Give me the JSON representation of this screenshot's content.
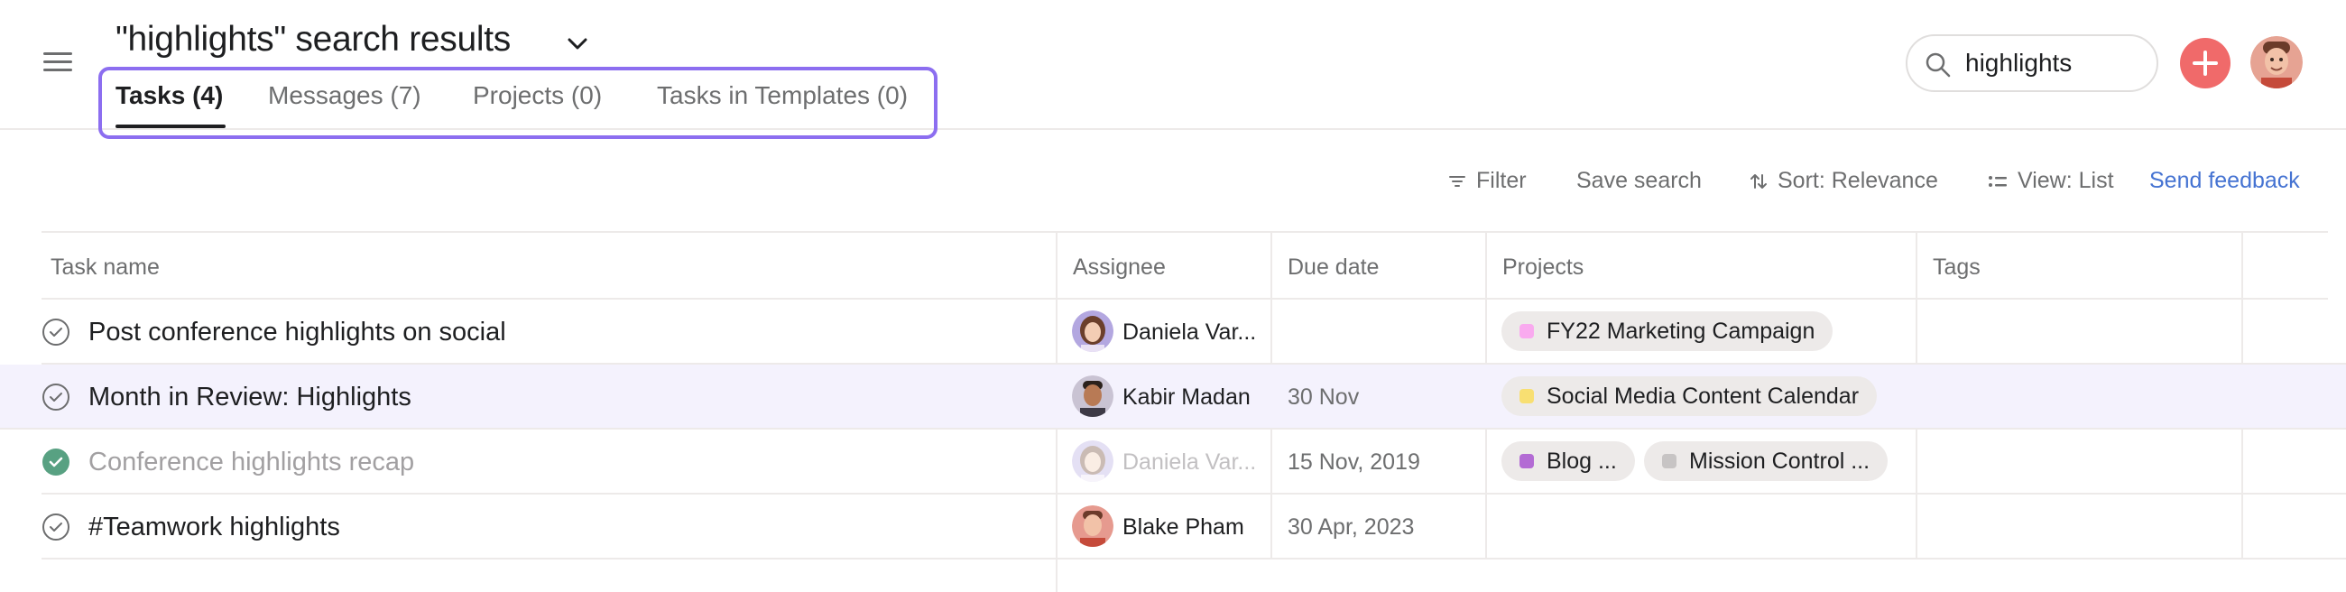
{
  "header": {
    "title": "\"highlights\" search results",
    "tabs": [
      {
        "label": "Tasks (4)"
      },
      {
        "label": "Messages (7)"
      },
      {
        "label": "Projects (0)"
      },
      {
        "label": "Tasks in Templates (0)"
      }
    ],
    "active_tab": "Tasks (4)",
    "search_value": "highlights",
    "icons": [
      "hamburger-menu-icon",
      "chevron-down-icon",
      "search-icon",
      "plus-icon",
      "user-avatar"
    ]
  },
  "toolbar": {
    "filter": "Filter",
    "save_search": "Save search",
    "sort": "Sort: Relevance",
    "view": "View: List",
    "feedback": "Send feedback"
  },
  "table": {
    "columns": [
      "Task name",
      "Assignee",
      "Due date",
      "Projects",
      "Tags"
    ],
    "rows": [
      {
        "name": "Post conference highlights on social",
        "completed": false,
        "assignee": "Daniela Var...",
        "due": "",
        "projects": [
          {
            "label": "FY22 Marketing Campaign",
            "color": "#f9aaef"
          }
        ]
      },
      {
        "name": "Month in Review: Highlights",
        "completed": false,
        "assignee": "Kabir Madan",
        "due": "30 Nov",
        "projects": [
          {
            "label": "Social Media Content Calendar",
            "color": "#f8df72"
          }
        ]
      },
      {
        "name": "Conference highlights recap",
        "completed": true,
        "assignee": "Daniela Var...",
        "due": "15 Nov, 2019",
        "projects": [
          {
            "label": "Blog ...",
            "color": "#b36bd4"
          },
          {
            "label": "Mission Control ...",
            "color": "#c7c4c4"
          }
        ]
      },
      {
        "name": "#Teamwork highlights",
        "completed": false,
        "assignee": "Blake Pham",
        "due": "30 Apr, 2023",
        "projects": []
      }
    ]
  },
  "colors": {
    "accent_outline": "#8c6ef0",
    "add_button": "#f06a6a",
    "link": "#4573d2",
    "completed_check": "#58a182",
    "hover_row": "#f4f2fd"
  }
}
